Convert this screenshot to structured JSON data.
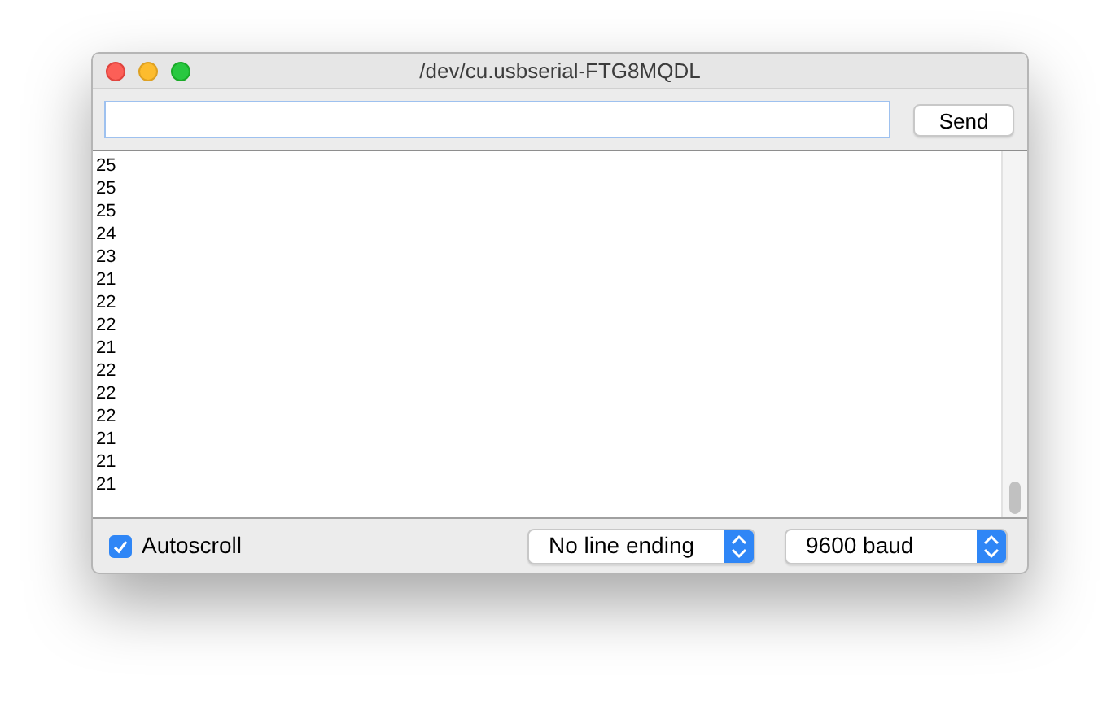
{
  "window": {
    "title": "/dev/cu.usbserial-FTG8MQDL"
  },
  "send_button": {
    "label": "Send"
  },
  "output_lines": [
    "25",
    "25",
    "25",
    "24",
    "23",
    "21",
    "22",
    "22",
    "21",
    "22",
    "22",
    "22",
    "21",
    "21",
    "21"
  ],
  "autoscroll": {
    "label": "Autoscroll",
    "checked": true
  },
  "line_ending": {
    "value": "No line ending"
  },
  "baud_rate": {
    "value": "9600 baud"
  }
}
